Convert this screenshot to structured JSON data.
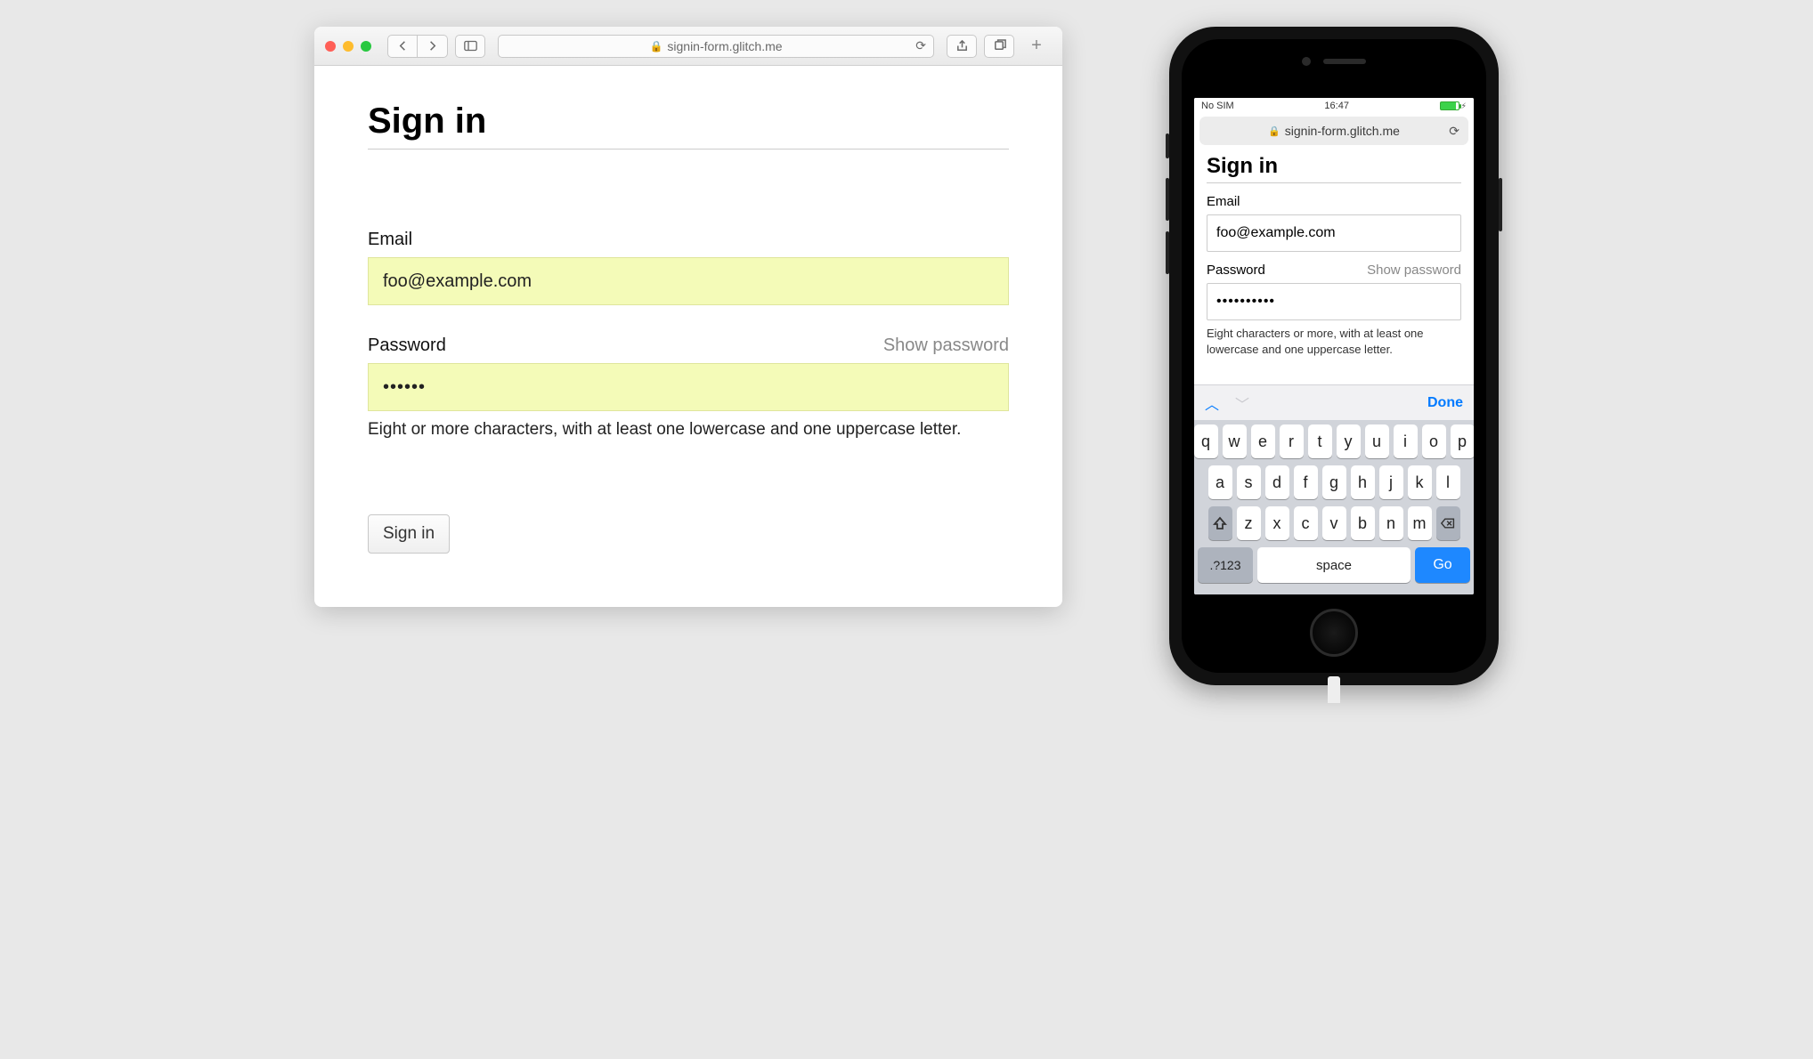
{
  "desktop": {
    "url_host": "signin-form.glitch.me",
    "page": {
      "title": "Sign in",
      "email_label": "Email",
      "email_value": "foo@example.com",
      "password_label": "Password",
      "show_password": "Show password",
      "password_masked": "••••••",
      "hint": "Eight or more characters, with at least one lowercase and one uppercase letter.",
      "submit": "Sign in"
    }
  },
  "phone": {
    "status": {
      "carrier": "No SIM",
      "time": "16:47"
    },
    "url_host": "signin-form.glitch.me",
    "page": {
      "title": "Sign in",
      "email_label": "Email",
      "email_value": "foo@example.com",
      "password_label": "Password",
      "show_password": "Show password",
      "password_masked": "••••••••••",
      "hint": "Eight characters or more, with at least one lowercase and one uppercase letter."
    },
    "accessory": {
      "done": "Done"
    },
    "keyboard": {
      "row1": [
        "q",
        "w",
        "e",
        "r",
        "t",
        "y",
        "u",
        "i",
        "o",
        "p"
      ],
      "row2": [
        "a",
        "s",
        "d",
        "f",
        "g",
        "h",
        "j",
        "k",
        "l"
      ],
      "row3": [
        "z",
        "x",
        "c",
        "v",
        "b",
        "n",
        "m"
      ],
      "num_key": ".?123",
      "space": "space",
      "go": "Go"
    }
  }
}
